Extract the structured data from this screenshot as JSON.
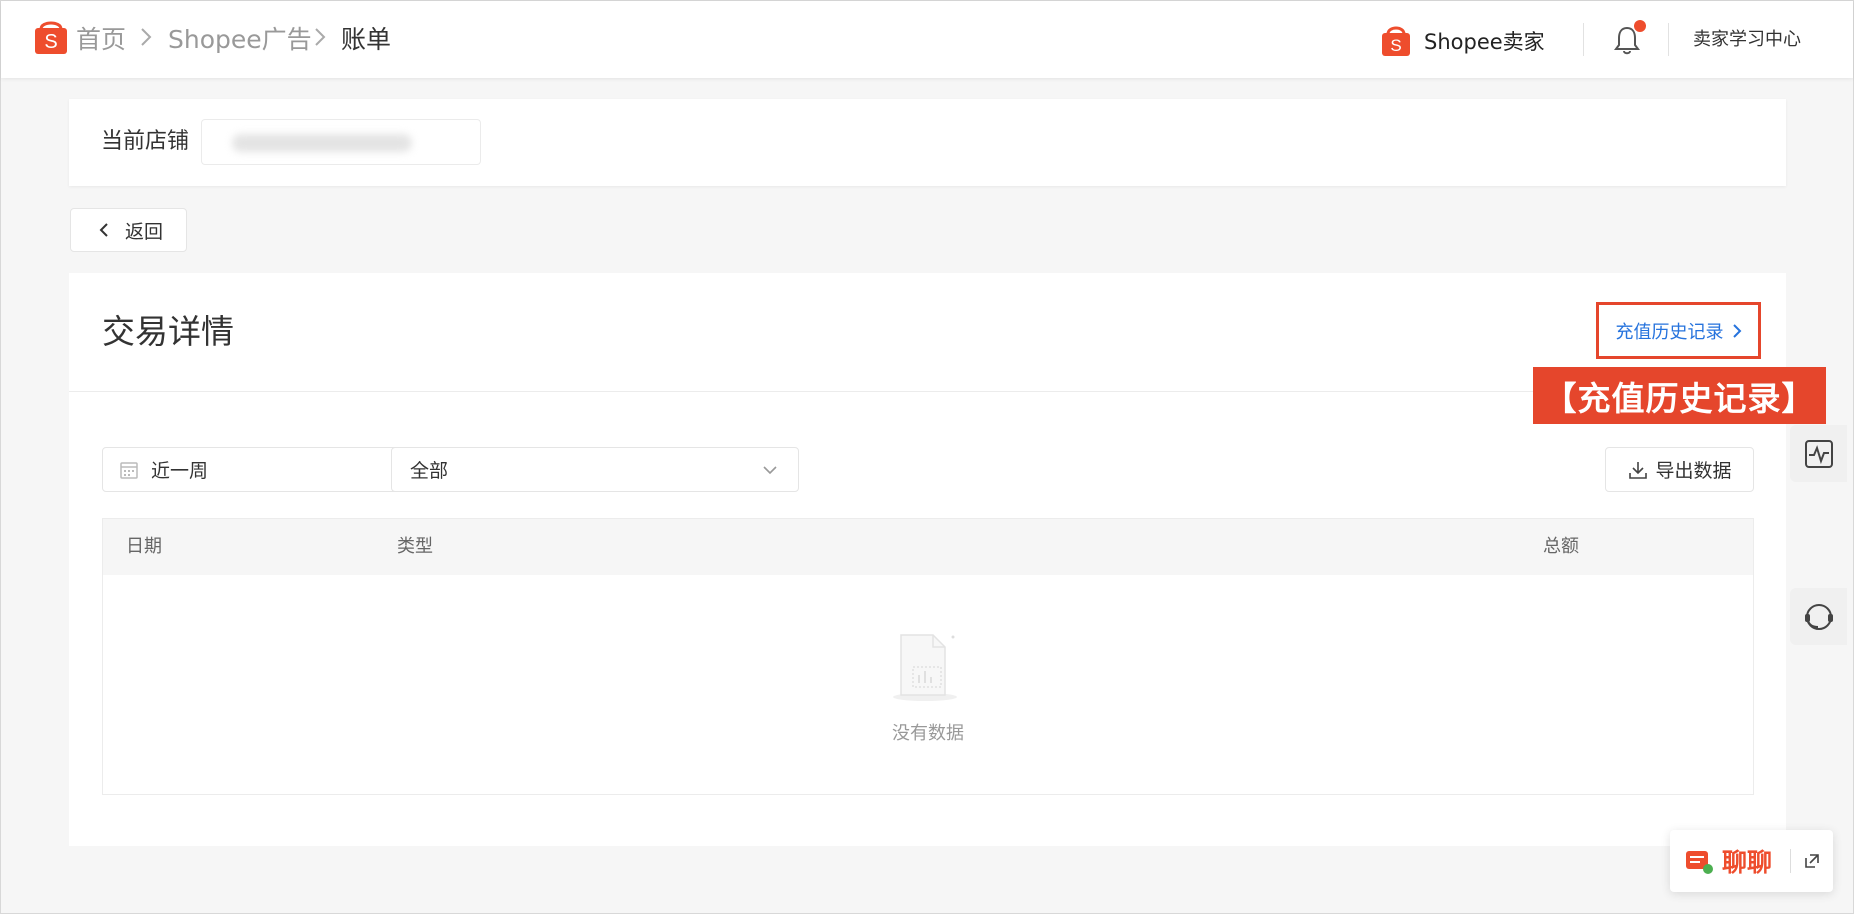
{
  "header": {
    "breadcrumb": [
      "首页",
      "Shopee广告",
      "账单"
    ],
    "brand": "Shopee卖家",
    "learning_center": "卖家学习中心"
  },
  "store": {
    "label": "当前店铺"
  },
  "back_label": "返回",
  "page": {
    "title": "交易详情",
    "history_link": "充值历史记录",
    "annotation": "【充值历史记录】"
  },
  "filters": {
    "date_range": "近一周",
    "type": "全部",
    "export": "导出数据"
  },
  "table": {
    "columns": [
      "日期",
      "类型",
      "总额"
    ],
    "empty_text": "没有数据"
  },
  "chat": {
    "label": "聊聊"
  },
  "colors": {
    "brand": "#ee4d2d",
    "link": "#2673dd",
    "annotation": "#e5462c"
  }
}
